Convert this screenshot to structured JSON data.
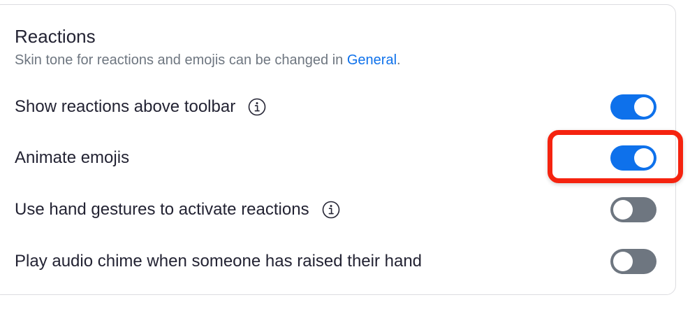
{
  "reactions": {
    "title": "Reactions",
    "subtitle_prefix": "Skin tone for reactions and emojis can be changed in ",
    "subtitle_link": "General",
    "subtitle_suffix": ".",
    "settings": [
      {
        "label": "Show reactions above toolbar",
        "has_info": true,
        "enabled": true
      },
      {
        "label": "Animate emojis",
        "has_info": false,
        "enabled": true
      },
      {
        "label": "Use hand gestures to activate reactions",
        "has_info": true,
        "enabled": false
      },
      {
        "label": "Play audio chime when someone has raised their hand",
        "has_info": false,
        "enabled": false
      }
    ]
  },
  "icons": {
    "info": "info-circle-icon"
  },
  "colors": {
    "toggle_on": "#0e71eb",
    "toggle_off": "#6e7680",
    "link": "#0e71eb",
    "highlight": "#f5230f"
  }
}
